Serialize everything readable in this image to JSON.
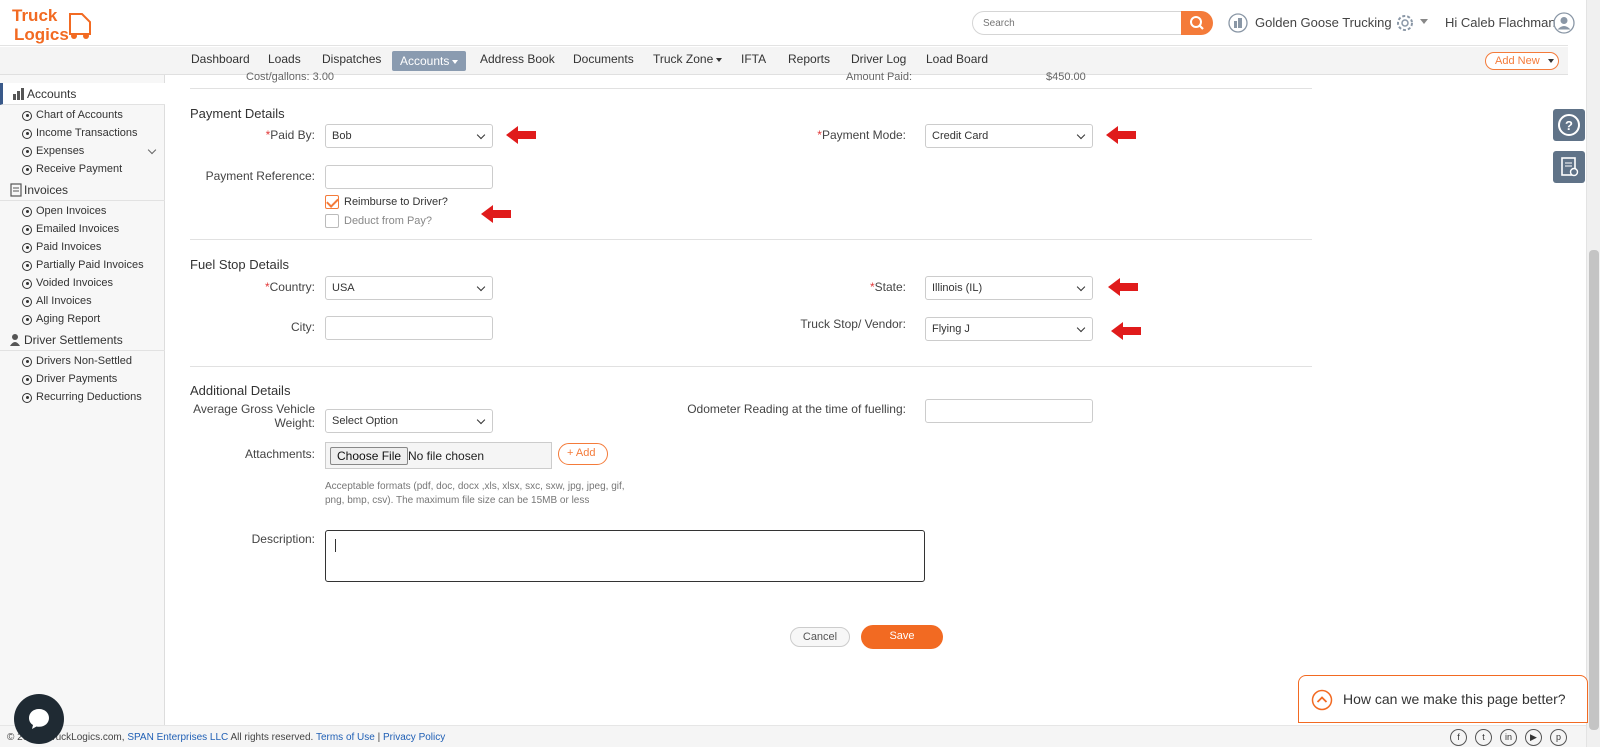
{
  "header": {
    "logo_text": "TruckLogics",
    "search_placeholder": "Search",
    "company": "Golden Goose Trucking",
    "greeting": "Hi Caleb Flachman"
  },
  "nav": {
    "items": [
      "Dashboard",
      "Loads",
      "Dispatches",
      "Accounts",
      "Address Book",
      "Documents",
      "Truck Zone",
      "IFTA",
      "Reports",
      "Driver Log",
      "Load Board"
    ],
    "active": "Accounts",
    "add_new": "Add New"
  },
  "sidebar": {
    "accounts": {
      "title": "Accounts",
      "items": [
        "Chart of Accounts",
        "Income Transactions",
        "Expenses",
        "Receive Payment"
      ]
    },
    "invoices": {
      "title": "Invoices",
      "items": [
        "Open Invoices",
        "Emailed Invoices",
        "Paid Invoices",
        "Partially Paid Invoices",
        "Voided Invoices",
        "All Invoices",
        "Aging Report"
      ]
    },
    "settlements": {
      "title": "Driver Settlements",
      "items": [
        "Drivers Non-Settled",
        "Driver Payments",
        "Recurring Deductions"
      ]
    }
  },
  "form": {
    "cut_left": "Cost/gallons:  3.00",
    "cut_right": "Amount Paid:",
    "cut_right_value": "$450.00",
    "payment": {
      "title": "Payment Details",
      "paid_by_label": "Paid By:",
      "paid_by_value": "Bob",
      "payment_mode_label": "Payment Mode:",
      "payment_mode_value": "Credit Card",
      "payment_reference_label": "Payment Reference:",
      "reimburse_label": "Reimburse to Driver?",
      "reimburse_checked": true,
      "deduct_label": "Deduct from Pay?",
      "deduct_checked": false
    },
    "fuel_stop": {
      "title": "Fuel Stop Details",
      "country_label": "Country:",
      "country_value": "USA",
      "state_label": "State:",
      "state_value": "Illinois (IL)",
      "city_label": "City:",
      "vendor_label": "Truck Stop/ Vendor:",
      "vendor_value": "Flying J"
    },
    "additional": {
      "title": "Additional Details",
      "weight_label_1": "Average Gross Vehicle",
      "weight_label_2": "Weight:",
      "weight_value": "Select Option",
      "odometer_label": "Odometer Reading at the time of fuelling:",
      "attachments_label": "Attachments:",
      "choose_file": "Choose File",
      "no_file": "No file chosen",
      "add_label": "Add",
      "formats_1": "Acceptable formats (pdf, doc, docx ,xls, xlsx, sxc, sxw, jpg, jpeg, gif,",
      "formats_2": "png, bmp, csv). The maximum file size can be 15MB or less",
      "description_label": "Description:"
    },
    "cancel": "Cancel",
    "save": "Save"
  },
  "feedback": "How can we make this page better?",
  "footer": {
    "copyright": "© 20",
    "copyright_rest": "ruckLogics.com,",
    "span": "SPAN Enterprises LLC",
    "rights": "All rights reserved.",
    "terms": "Terms of Use",
    "sep": "|",
    "privacy": "Privacy Policy"
  },
  "colors": {
    "accent": "#f26a22",
    "annotation_arrow": "#e01b1b",
    "nav_active": "#8a9bb0"
  }
}
